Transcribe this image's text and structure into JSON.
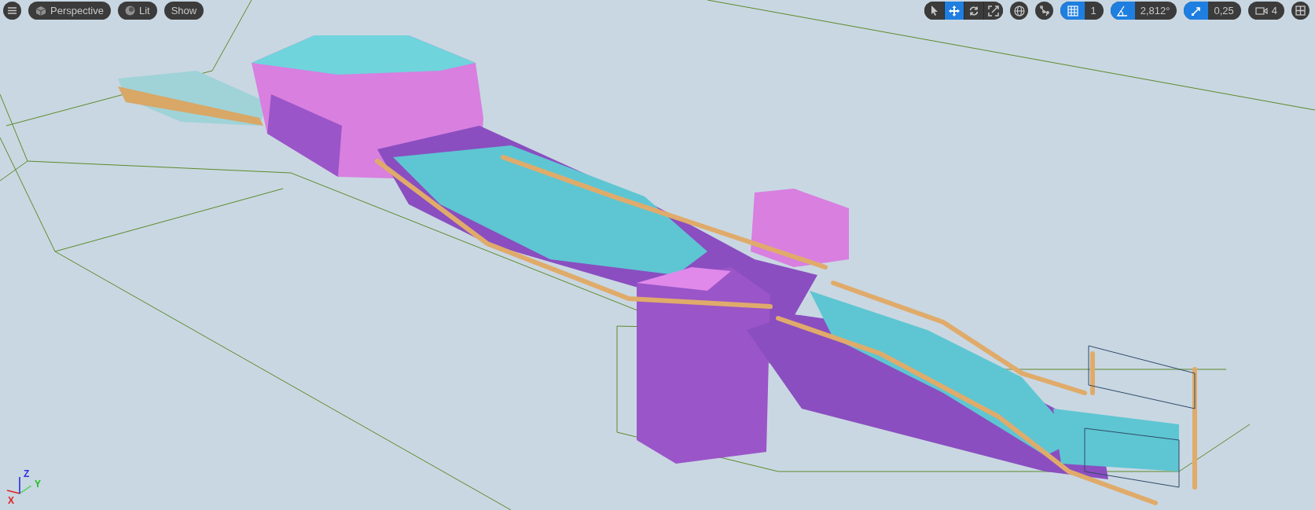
{
  "viewport_toolbar_left": {
    "view_mode": "Perspective",
    "lighting": "Lit",
    "show": "Show"
  },
  "transform_tools": [
    {
      "kind": "select",
      "selected": false
    },
    {
      "kind": "move",
      "selected": true
    },
    {
      "kind": "rotate",
      "selected": false
    },
    {
      "kind": "scale",
      "selected": false
    }
  ],
  "snaps": [
    {
      "kind": "grid",
      "on": true,
      "value": "1"
    },
    {
      "kind": "rotation",
      "on": true,
      "value": "2,812°"
    },
    {
      "kind": "scale",
      "on": true,
      "value": "0,25"
    }
  ],
  "camera_speed": "4",
  "axis_gizmo": {
    "x": "X",
    "y": "Y",
    "z": "Z"
  }
}
